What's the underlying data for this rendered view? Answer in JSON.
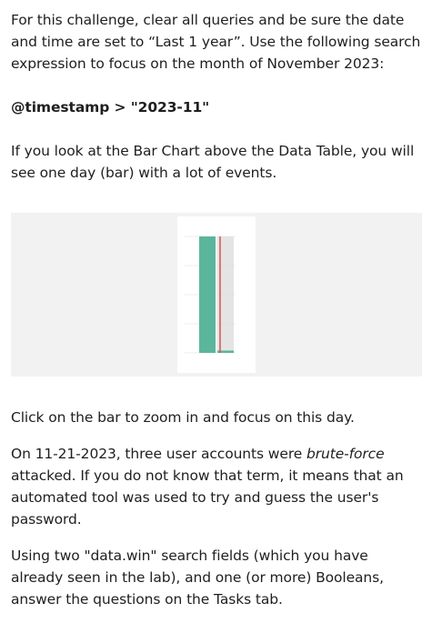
{
  "instructions": {
    "para1": "For this challenge, clear all queries and be sure the date and time are set to “Last 1 year”.  Use the following search expression to focus on the month of November 2023:",
    "search_expression": "@timestamp > \"2023-11\"",
    "para3": "If you look at the Bar Chart above the Data Table, you will see one day (bar) with a lot of events.",
    "para4": "Click on the bar to zoom in and focus on this day.",
    "para5_before": "On 11-21-2023, three user accounts were ",
    "para5_em": "brute-force",
    "para5_after": " attacked. If you do not know that term, it means that an automated tool was used to try and guess the user's password.",
    "para6": "Using two \"data.win\" search fields (which you have already seen in the lab), and one (or more) Booleans, answer the questions on the Tasks tab."
  },
  "chart_data": {
    "type": "bar",
    "categories": [
      "",
      ""
    ],
    "series": [
      {
        "name": "",
        "values": [
          1,
          0.02
        ],
        "color": "#5bb69c"
      }
    ],
    "highlight_color": "#d9d9d9",
    "marker_color": "#d9534f"
  }
}
